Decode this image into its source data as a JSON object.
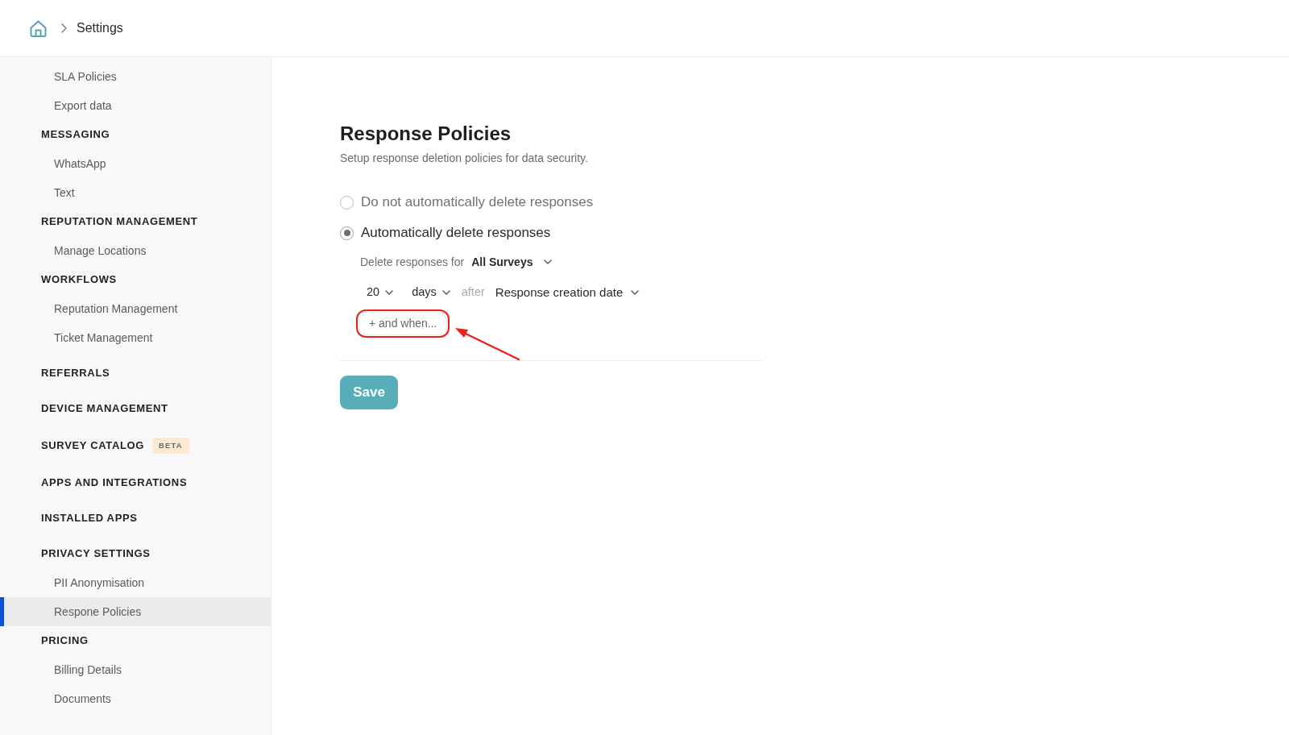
{
  "breadcrumb": {
    "current": "Settings"
  },
  "sidebar": {
    "items": [
      {
        "kind": "item",
        "label": "SLA Policies",
        "selected": false
      },
      {
        "kind": "item",
        "label": "Export data",
        "selected": false
      },
      {
        "kind": "section",
        "label": "MESSAGING",
        "children": [
          {
            "kind": "item",
            "label": "WhatsApp",
            "selected": false
          },
          {
            "kind": "item",
            "label": "Text",
            "selected": false
          }
        ]
      },
      {
        "kind": "section",
        "label": "REPUTATION MANAGEMENT",
        "children": [
          {
            "kind": "item",
            "label": "Manage Locations",
            "selected": false
          }
        ]
      },
      {
        "kind": "section",
        "label": "WORKFLOWS",
        "children": [
          {
            "kind": "item",
            "label": "Reputation Management",
            "selected": false
          },
          {
            "kind": "item",
            "label": "Ticket Management",
            "selected": false
          }
        ]
      },
      {
        "kind": "section",
        "label": "REFERRALS"
      },
      {
        "kind": "section",
        "label": "DEVICE MANAGEMENT"
      },
      {
        "kind": "section",
        "label": "SURVEY CATALOG",
        "badge": "BETA"
      },
      {
        "kind": "section",
        "label": "APPS AND INTEGRATIONS"
      },
      {
        "kind": "section",
        "label": "INSTALLED APPS"
      },
      {
        "kind": "section",
        "label": "PRIVACY SETTINGS",
        "children": [
          {
            "kind": "item",
            "label": "PII Anonymisation",
            "selected": false
          },
          {
            "kind": "item",
            "label": "Respone Policies",
            "selected": true
          }
        ]
      },
      {
        "kind": "section",
        "label": "PRICING",
        "children": [
          {
            "kind": "item",
            "label": "Billing Details",
            "selected": false
          },
          {
            "kind": "item",
            "label": "Documents",
            "selected": false
          }
        ]
      }
    ]
  },
  "page": {
    "title": "Response Policies",
    "subtitle": "Setup response deletion policies for data security."
  },
  "policy_options": [
    {
      "label": "Do not automatically delete responses",
      "selected": false
    },
    {
      "label": "Automatically delete responses",
      "selected": true
    }
  ],
  "scope": {
    "label": "Delete responses for",
    "value": "All Surveys"
  },
  "rule": {
    "amount": "20",
    "unit": "days",
    "connector": "after",
    "reference": "Response creation date"
  },
  "add_condition": {
    "label": "+ and when...",
    "highlighted": true
  },
  "save_button": {
    "label": "Save"
  }
}
